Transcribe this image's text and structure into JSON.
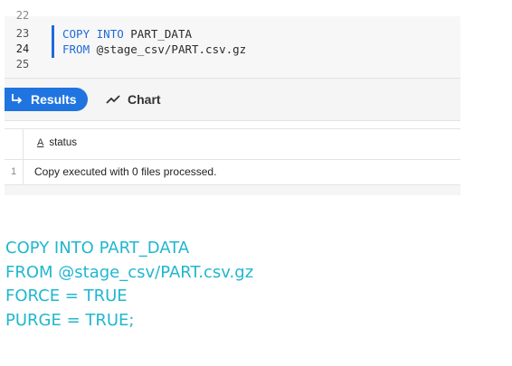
{
  "editor": {
    "line_numbers": [
      "22",
      "23",
      "24",
      "25"
    ],
    "lines": [
      {
        "keyword1": "COPY",
        "keyword2": "INTO",
        "rest": " PART_DATA"
      },
      {
        "keyword1": "FROM",
        "rest": " @stage_csv/PART.csv.gz"
      }
    ]
  },
  "toolbar": {
    "results_label": "Results",
    "chart_label": "Chart"
  },
  "grid": {
    "column_type_icon": "A",
    "columns": [
      "status"
    ],
    "rows": [
      {
        "num": "1",
        "status": "Copy executed with 0 files processed."
      }
    ]
  },
  "sql_snippet": [
    "COPY INTO PART_DATA",
    "FROM @stage_csv/PART.csv.gz",
    "FORCE = TRUE",
    "PURGE = TRUE;"
  ],
  "colors": {
    "accent": "#1f74e0",
    "snippet_text": "#20b7cf"
  }
}
